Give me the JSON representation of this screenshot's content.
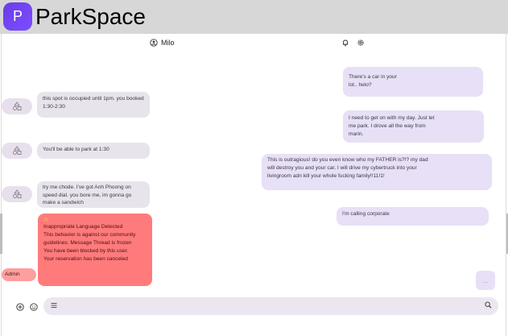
{
  "app": {
    "logo_letter": "P",
    "title": "ParkSpace"
  },
  "chat_header": {
    "user_name": "Milo",
    "user_icon": "account-circle-icon",
    "bell_icon": "bell-icon",
    "settings_icon": "gear-icon"
  },
  "messages_incoming": [
    {
      "text": "this spot is occupied until 1pm. you booked 1:30-2:30"
    },
    {
      "text": "You'll be able to park at 1:30"
    },
    {
      "text": "try me chode. I've got Anh Phoong on speed dial. you bore me, im gonna go make a sandwich"
    }
  ],
  "messages_outgoing": [
    {
      "text": "There's a car in your lot.. helo?"
    },
    {
      "text": "I need to get on with my day. Just let me park. I drove all the way from marin."
    },
    {
      "text": "This is outragious! do you even know who my FATHER is?!?  my dad will destroy you and your car. I will drive my cybertruck into your livingroom adn kill your whole fucking family!!11!1!"
    },
    {
      "text": "I'm calling corporate"
    }
  ],
  "moderation": {
    "icon": "warning-icon",
    "lines": [
      "Inappropriate Language Detected",
      "This behavior is against our community guidelines. Message Thread is frozen",
      "You have been blocked by this user.",
      "Your reservation has been canceled"
    ],
    "badge": "Admin"
  },
  "typing_indicator": "...",
  "composer": {
    "add_icon": "add-circle-icon",
    "emoji_icon": "emoji-icon",
    "menu_icon": "menu-icon",
    "search_icon": "search-icon",
    "placeholder": ""
  },
  "colors": {
    "accent": "#6a3de8",
    "incoming_bubble": "#e8e4ec",
    "outgoing_bubble": "#e7e0f6",
    "moderation_bubble": "#ff7b7b"
  }
}
